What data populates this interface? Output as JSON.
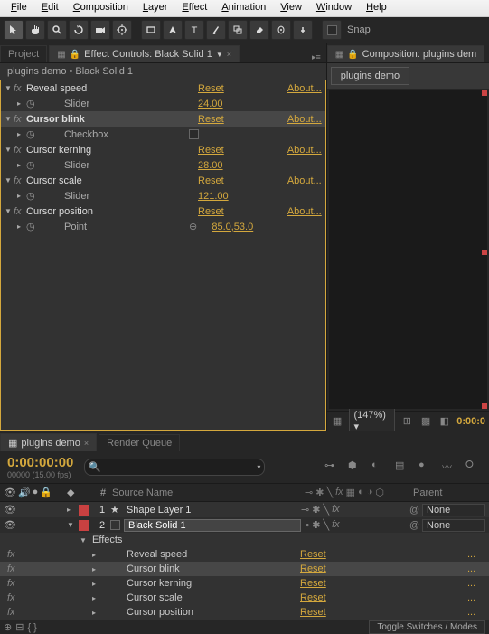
{
  "menu": [
    "File",
    "Edit",
    "Composition",
    "Layer",
    "Effect",
    "Animation",
    "View",
    "Window",
    "Help"
  ],
  "toolbar": {
    "snap_label": "Snap"
  },
  "panels": {
    "project_tab": "Project",
    "effect_controls_prefix": "Effect Controls: ",
    "effect_controls_layer": "Black Solid 1",
    "composition_prefix": "Composition: ",
    "composition_name": "plugins dem",
    "subtitle": "plugins demo • Black Solid 1",
    "comp_nested_tab": "plugins demo"
  },
  "effects": [
    {
      "name": "Reveal speed",
      "reset": "Reset",
      "about": "About...",
      "param": "Slider",
      "value": "24.00",
      "selected": false
    },
    {
      "name": "Cursor blink",
      "reset": "Reset",
      "about": "About...",
      "param": "Checkbox",
      "value": "",
      "selected": true,
      "is_checkbox": true
    },
    {
      "name": "Cursor kerning",
      "reset": "Reset",
      "about": "About...",
      "param": "Slider",
      "value": "28.00",
      "selected": false
    },
    {
      "name": "Cursor scale",
      "reset": "Reset",
      "about": "About...",
      "param": "Slider",
      "value": "121.00",
      "selected": false
    },
    {
      "name": "Cursor position",
      "reset": "Reset",
      "about": "About...",
      "param": "Point",
      "value": "85.0,53.0",
      "selected": false,
      "is_point": true
    }
  ],
  "comp_footer": {
    "zoom": "(147%)",
    "time": "0:00:0"
  },
  "timeline": {
    "tabs": {
      "comp": "plugins demo",
      "render": "Render Queue"
    },
    "timecode": "0:00:00:00",
    "sub": "00000 (15.00 fps)",
    "columns": {
      "num": "#",
      "source": "Source Name",
      "parent": "Parent"
    },
    "layers": [
      {
        "num": "1",
        "name": "Shape Layer 1",
        "color": "#c94141",
        "is_shape": true,
        "parent": "None"
      },
      {
        "num": "2",
        "name": "Black Solid 1",
        "color": "#c94141",
        "is_shape": false,
        "parent": "None",
        "boxed": true
      }
    ],
    "effects_label": "Effects",
    "fx_rows": [
      {
        "name": "Reveal speed",
        "reset": "Reset",
        "dots": "...",
        "sel": false
      },
      {
        "name": "Cursor blink",
        "reset": "Reset",
        "dots": "...",
        "sel": true
      },
      {
        "name": "Cursor kerning",
        "reset": "Reset",
        "dots": "...",
        "sel": false
      },
      {
        "name": "Cursor scale",
        "reset": "Reset",
        "dots": "...",
        "sel": false
      },
      {
        "name": "Cursor position",
        "reset": "Reset",
        "dots": "...",
        "sel": false
      }
    ],
    "footer_toggle": "Toggle Switches / Modes"
  }
}
